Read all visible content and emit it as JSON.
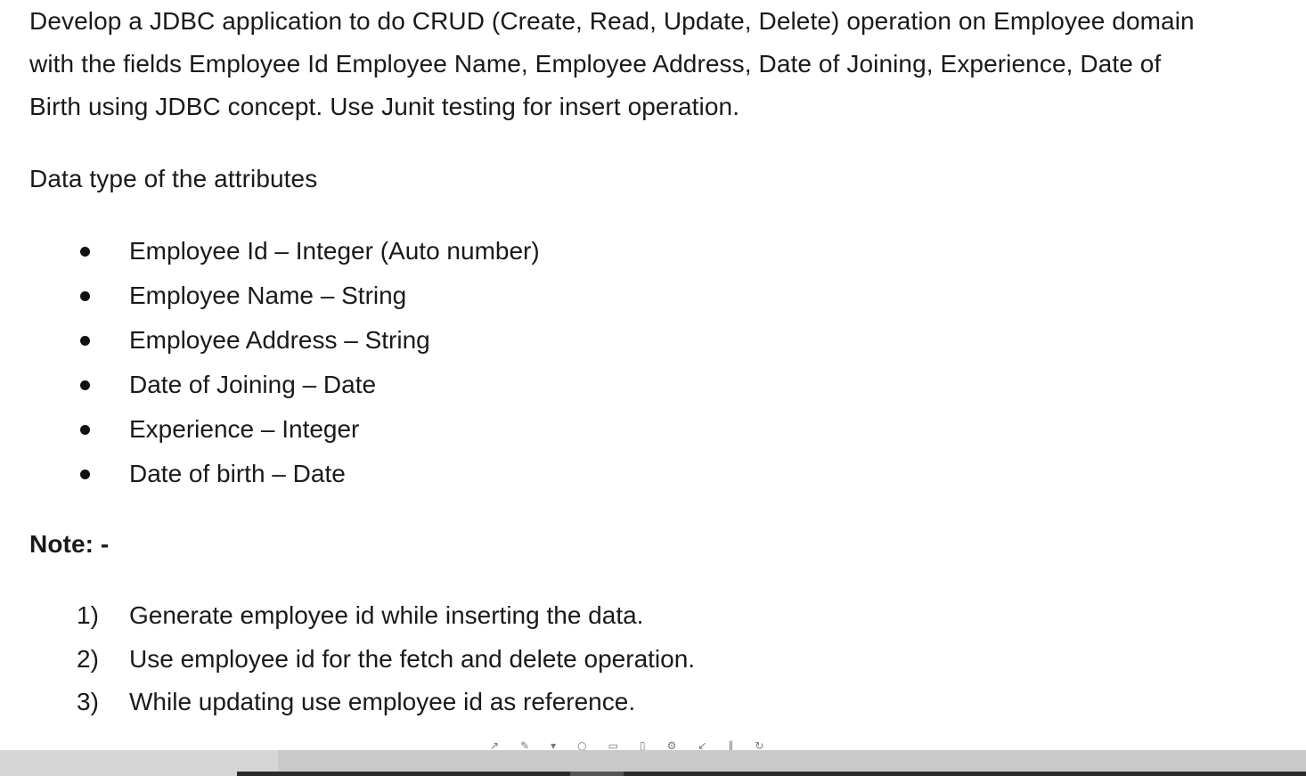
{
  "document": {
    "intro_lines": [
      "Develop a JDBC application to do CRUD (Create, Read, Update, Delete) operation on Employee domain",
      "with the fields Employee Id Employee Name, Employee Address, Date of Joining, Experience, Date of",
      "Birth using JDBC concept. Use Junit testing for insert operation."
    ],
    "datatype_heading": "Data type of the attributes",
    "attributes": [
      "Employee Id – Integer (Auto number)",
      "Employee Name – String",
      "Employee Address – String",
      "Date of Joining – Date",
      "Experience – Integer",
      "Date of birth – Date"
    ],
    "note_heading": "Note: -",
    "notes": [
      {
        "num": "1)",
        "text": "Generate employee id while inserting the data."
      },
      {
        "num": "2)",
        "text": "Use employee id for the fetch and delete operation."
      },
      {
        "num": "3)",
        "text": "While updating use employee id as reference."
      }
    ]
  },
  "taskbar": {
    "icons": [
      "arrow-icon",
      "pen-icon",
      "marker-icon",
      "circle-icon",
      "folder-icon",
      "clipboard-icon",
      "settings-icon",
      "pin-icon",
      "pause-icon",
      "refresh-icon"
    ]
  }
}
